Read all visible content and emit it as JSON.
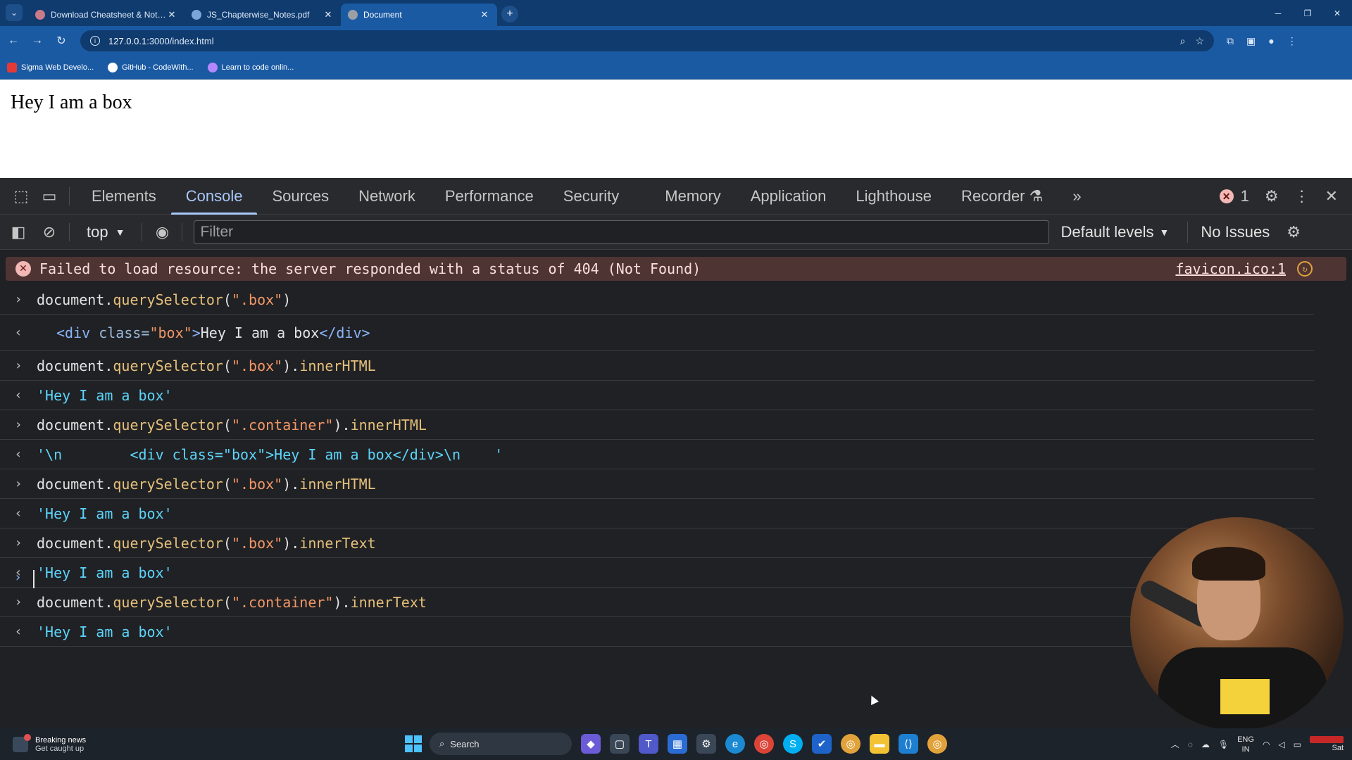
{
  "browser": {
    "tabs": [
      {
        "title": "Download Cheatsheet & Notes",
        "favicon_color": "#c97b8a"
      },
      {
        "title": "JS_Chapterwise_Notes.pdf",
        "favicon_color": "#7aa7d9"
      },
      {
        "title": "Document",
        "favicon_color": "#9aa0a6"
      }
    ],
    "url_host": "127.0.0.1",
    "url_path": ":3000/index.html",
    "bookmarks": [
      {
        "label": "Sigma Web Develo...",
        "color": "#e53935"
      },
      {
        "label": "GitHub - CodeWith...",
        "color": "#ffffff"
      },
      {
        "label": "Learn to code onlin...",
        "color": "#b388ff"
      }
    ]
  },
  "page": {
    "text": "Hey I am a box"
  },
  "devtools": {
    "tabs": [
      "Elements",
      "Console",
      "Sources",
      "Network",
      "Performance",
      "Security",
      "Memory",
      "Application",
      "Lighthouse",
      "Recorder"
    ],
    "active_tab": "Console",
    "error_count": "1",
    "context": "top",
    "filter_placeholder": "Filter",
    "levels": "Default levels",
    "issues": "No Issues"
  },
  "console": {
    "error": {
      "message": "Failed to load resource: the server responded with a status of 404 (Not Found)",
      "source": "favicon.ico:1"
    },
    "entries": [
      {
        "kind": "input",
        "obj": "document",
        "dot": ".",
        "method": "querySelector",
        "open": "(",
        "arg": "\".box\"",
        "close": ")",
        "prop": ""
      },
      {
        "kind": "html",
        "text_open": "<div ",
        "attr": "class=",
        "value": "\"box\"",
        "gt": ">",
        "inner": "Hey I am a box",
        "text_close": "</div>"
      },
      {
        "kind": "input",
        "obj": "document",
        "dot": ".",
        "method": "querySelector",
        "open": "(",
        "arg": "\".box\"",
        "close": ").",
        "prop": "innerHTML"
      },
      {
        "kind": "result",
        "text": "'Hey I am a box'"
      },
      {
        "kind": "input",
        "obj": "document",
        "dot": ".",
        "method": "querySelector",
        "open": "(",
        "arg": "\".container\"",
        "close": ").",
        "prop": "innerHTML"
      },
      {
        "kind": "result",
        "text": "'\\n        <div class=\"box\">Hey I am a box</div>\\n    '"
      },
      {
        "kind": "input",
        "obj": "document",
        "dot": ".",
        "method": "querySelector",
        "open": "(",
        "arg": "\".box\"",
        "close": ").",
        "prop": "innerHTML"
      },
      {
        "kind": "result",
        "text": "'Hey I am a box'"
      },
      {
        "kind": "input",
        "obj": "document",
        "dot": ".",
        "method": "querySelector",
        "open": "(",
        "arg": "\".box\"",
        "close": ").",
        "prop": "innerText"
      },
      {
        "kind": "result",
        "text": "'Hey I am a box'"
      },
      {
        "kind": "input",
        "obj": "document",
        "dot": ".",
        "method": "querySelector",
        "open": "(",
        "arg": "\".container\"",
        "close": ").",
        "prop": "innerText"
      },
      {
        "kind": "result",
        "text": "'Hey I am a box'"
      }
    ]
  },
  "taskbar": {
    "news_title": "Breaking news",
    "news_sub": "Get caught up",
    "search_label": "Search",
    "lang_top": "ENG",
    "lang_bottom": "IN",
    "day": "Sat"
  }
}
